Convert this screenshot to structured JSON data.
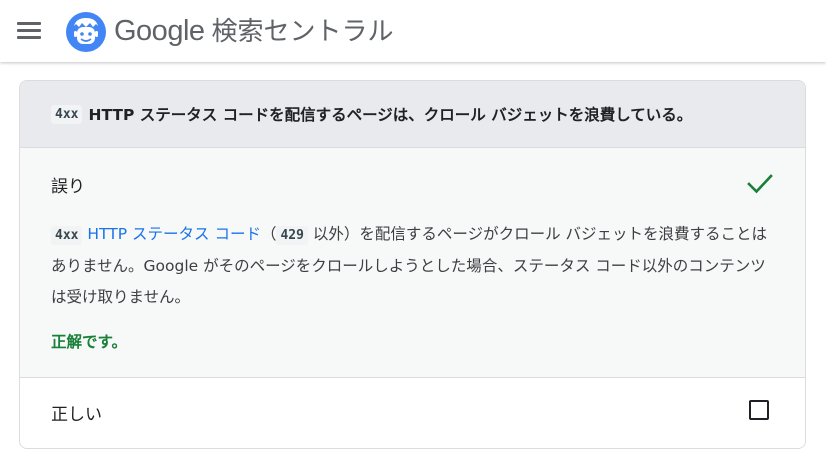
{
  "header": {
    "brand_google": "Google",
    "brand_product": "検索セントラル",
    "menu_icon": "hamburger-menu-icon",
    "logo_icon": "search-central-mascot-icon"
  },
  "quiz": {
    "question": {
      "code": "4xx",
      "text": "HTTP ステータス コードを配信するページは、クロール バジェットを浪費している。"
    },
    "options": [
      {
        "label": "誤り",
        "state": "selected-correct",
        "icon": "check-icon",
        "explanation": {
          "code1": "4xx",
          "link": "HTTP ステータス コード",
          "paren_open": "（",
          "code2": "429",
          "text1": "以外）を配信するページがクロール バジェットを浪費することはありません。Google がそのページをクロールしようとした場合、ステータス コード以外のコンテンツは受け取りません。"
        },
        "feedback": "正解です。"
      },
      {
        "label": "正しい",
        "state": "unselected",
        "icon": "checkbox-icon"
      }
    ]
  },
  "colors": {
    "link": "#1a73e8",
    "success": "#188038",
    "question_bg": "#e8eaed"
  }
}
